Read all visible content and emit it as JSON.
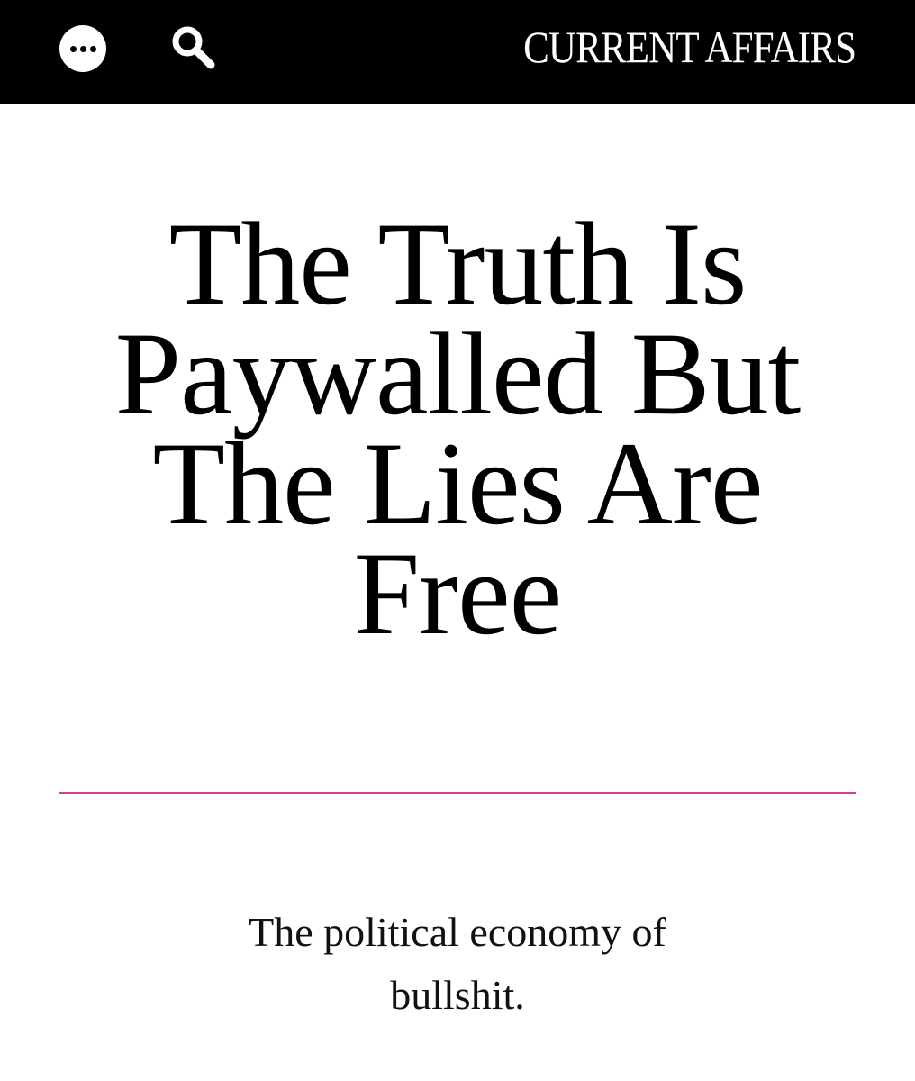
{
  "header": {
    "brand": "CURRENT AFFAIRS",
    "menu_icon": "more-dots-icon",
    "search_icon": "search-icon",
    "background_color": "#000000",
    "brand_color": "#ffffff"
  },
  "article": {
    "headline": "The Truth Is Paywalled But The Lies Are Free",
    "dek": "The political economy of bullshit.",
    "divider_color": "#d63b9a"
  }
}
